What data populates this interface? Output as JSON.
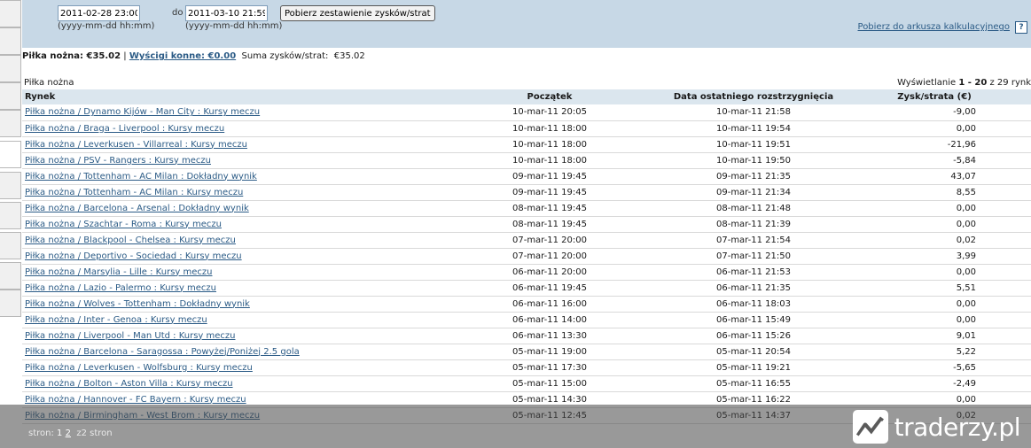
{
  "filter": {
    "from_value": "2011-02-28 23:00",
    "from_hint": "(yyyy-mm-dd hh:mm)",
    "to_label": "do",
    "to_value": "2011-03-10 21:59",
    "to_hint": "(yyyy-mm-dd hh:mm)",
    "fetch_button": "Pobierz zestawienie zysków/strat",
    "sheet_link": "Pobierz do arkusza kalkulacyjnego",
    "help_label": "?"
  },
  "summary": {
    "football": "Piłka nożna: €35.02",
    "separator": "|",
    "horse_racing": "Wyścigi konne: €0.00",
    "total_label": "Suma zysków/strat:",
    "total_value": "€35.02"
  },
  "section_label": "Piłka nożna",
  "showing": {
    "prefix": "Wyświetlanie",
    "range": "1 - 20",
    "suffix": "z 29 rynk"
  },
  "table": {
    "headers": [
      "Rynek",
      "Początek",
      "Data ostatniego rozstrzygnięcia",
      "Zysk/strata (€)"
    ],
    "rows": [
      {
        "market": "Piłka nożna / Dynamo Kijów - Man City : Kursy meczu",
        "start": "10-mar-11 20:05",
        "settled": "10-mar-11 21:58",
        "pl": "-9,00"
      },
      {
        "market": "Piłka nożna / Braga - Liverpool : Kursy meczu",
        "start": "10-mar-11 18:00",
        "settled": "10-mar-11 19:54",
        "pl": "0,00"
      },
      {
        "market": "Piłka nożna / Leverkusen - Villarreal : Kursy meczu",
        "start": "10-mar-11 18:00",
        "settled": "10-mar-11 19:51",
        "pl": "-21,96"
      },
      {
        "market": "Piłka nożna / PSV - Rangers : Kursy meczu",
        "start": "10-mar-11 18:00",
        "settled": "10-mar-11 19:50",
        "pl": "-5,84"
      },
      {
        "market": "Piłka nożna / Tottenham - AC Milan : Dokładny wynik",
        "start": "09-mar-11 19:45",
        "settled": "09-mar-11 21:35",
        "pl": "43,07"
      },
      {
        "market": "Piłka nożna / Tottenham - AC Milan : Kursy meczu",
        "start": "09-mar-11 19:45",
        "settled": "09-mar-11 21:34",
        "pl": "8,55"
      },
      {
        "market": "Piłka nożna / Barcelona - Arsenal : Dokładny wynik",
        "start": "08-mar-11 19:45",
        "settled": "08-mar-11 21:48",
        "pl": "0,00"
      },
      {
        "market": "Piłka nożna / Szachtar - Roma : Kursy meczu",
        "start": "08-mar-11 19:45",
        "settled": "08-mar-11 21:39",
        "pl": "0,00"
      },
      {
        "market": "Piłka nożna / Blackpool - Chelsea : Kursy meczu",
        "start": "07-mar-11 20:00",
        "settled": "07-mar-11 21:54",
        "pl": "0,02"
      },
      {
        "market": "Piłka nożna / Deportivo - Sociedad : Kursy meczu",
        "start": "07-mar-11 20:00",
        "settled": "07-mar-11 21:50",
        "pl": "3,99"
      },
      {
        "market": "Piłka nożna / Marsylia - Lille : Kursy meczu",
        "start": "06-mar-11 20:00",
        "settled": "06-mar-11 21:53",
        "pl": "0,00"
      },
      {
        "market": "Piłka nożna / Lazio - Palermo : Kursy meczu",
        "start": "06-mar-11 19:45",
        "settled": "06-mar-11 21:35",
        "pl": "5,51"
      },
      {
        "market": "Piłka nożna / Wolves - Tottenham : Dokładny wynik",
        "start": "06-mar-11 16:00",
        "settled": "06-mar-11 18:03",
        "pl": "0,00"
      },
      {
        "market": "Piłka nożna / Inter - Genoa : Kursy meczu",
        "start": "06-mar-11 14:00",
        "settled": "06-mar-11 15:49",
        "pl": "0,00"
      },
      {
        "market": "Piłka nożna / Liverpool - Man Utd : Kursy meczu",
        "start": "06-mar-11 13:30",
        "settled": "06-mar-11 15:26",
        "pl": "9,01"
      },
      {
        "market": "Piłka nożna / Barcelona - Saragossa : Powyżej/Poniżej 2.5 gola",
        "start": "05-mar-11 19:00",
        "settled": "05-mar-11 20:54",
        "pl": "5,22"
      },
      {
        "market": "Piłka nożna / Leverkusen - Wolfsburg : Kursy meczu",
        "start": "05-mar-11 17:30",
        "settled": "05-mar-11 19:21",
        "pl": "-5,65"
      },
      {
        "market": "Piłka nożna / Bolton - Aston Villa : Kursy meczu",
        "start": "05-mar-11 15:00",
        "settled": "05-mar-11 16:55",
        "pl": "-2,49"
      },
      {
        "market": "Piłka nożna / Hannover - FC Bayern : Kursy meczu",
        "start": "05-mar-11 14:30",
        "settled": "05-mar-11 16:22",
        "pl": "0,00"
      },
      {
        "market": "Piłka nożna / Birmingham - West Brom : Kursy meczu",
        "start": "05-mar-11 12:45",
        "settled": "05-mar-11 14:37",
        "pl": "0,02"
      }
    ]
  },
  "pager": {
    "label": "stron:",
    "current": "1",
    "next": "2",
    "total": "z2 stron"
  },
  "watermark": {
    "text": "traderzy.pl"
  }
}
